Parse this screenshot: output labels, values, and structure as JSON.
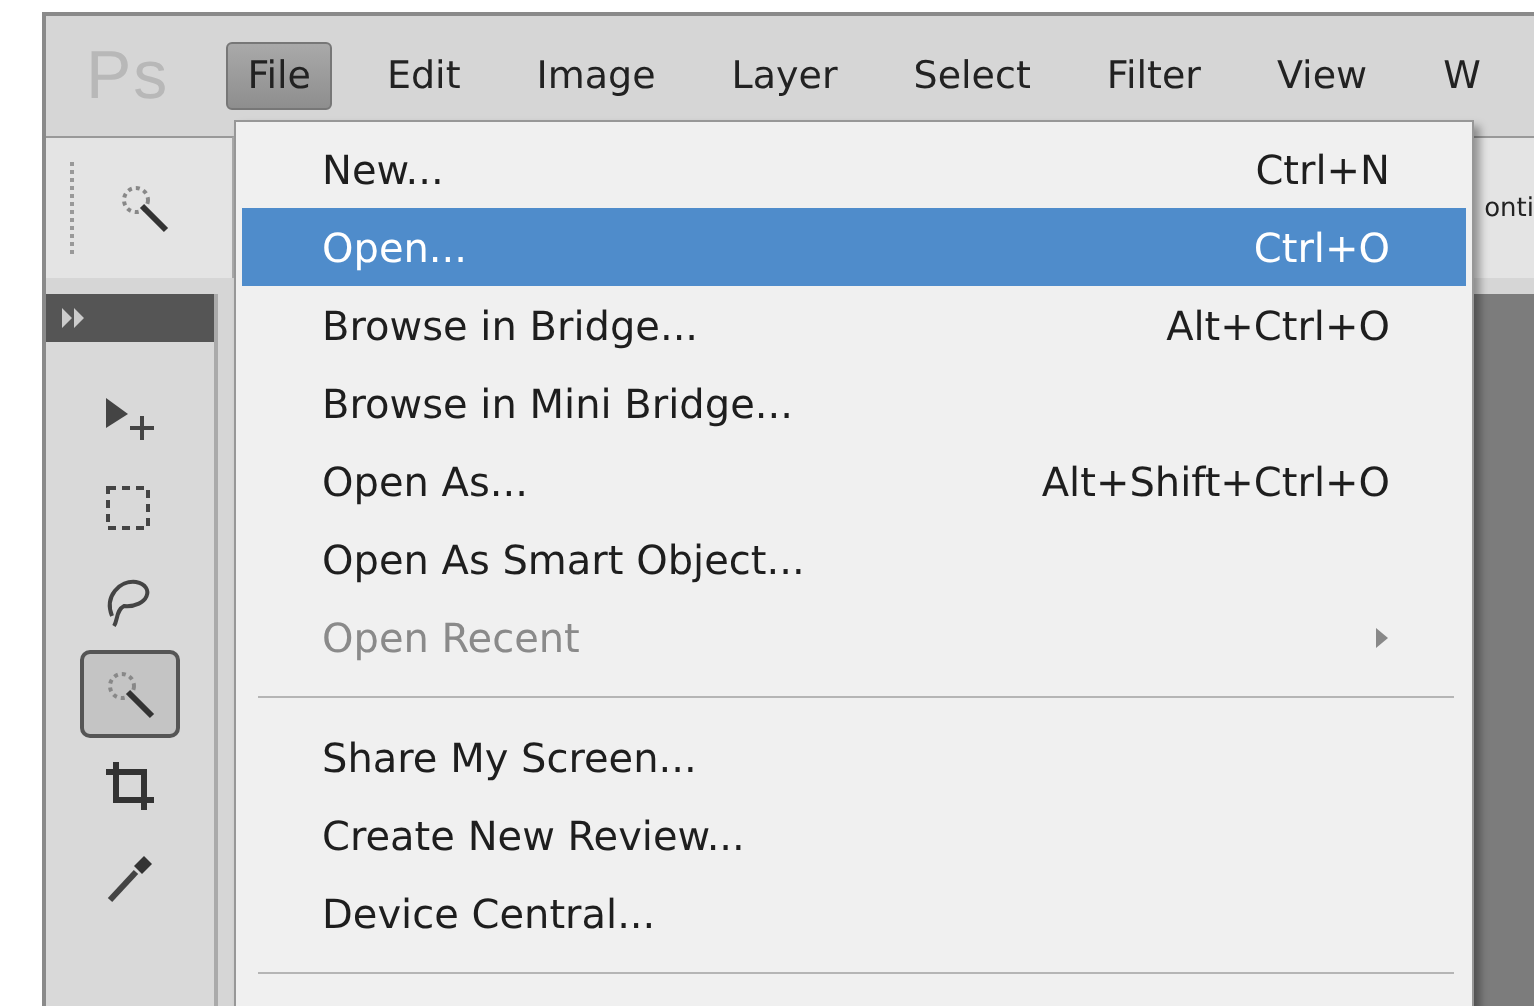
{
  "app_logo": "Ps",
  "menu_bar": [
    {
      "label": "File",
      "selected": true
    },
    {
      "label": "Edit",
      "selected": false
    },
    {
      "label": "Image",
      "selected": false
    },
    {
      "label": "Layer",
      "selected": false
    },
    {
      "label": "Select",
      "selected": false
    },
    {
      "label": "Filter",
      "selected": false
    },
    {
      "label": "View",
      "selected": false
    },
    {
      "label": "W",
      "selected": false
    }
  ],
  "options_bar": {
    "text": "onti"
  },
  "tools": [
    {
      "kind": "move",
      "selected": false
    },
    {
      "kind": "marquee",
      "selected": false
    },
    {
      "kind": "lasso",
      "selected": false
    },
    {
      "kind": "wand",
      "selected": true
    },
    {
      "kind": "crop",
      "selected": false
    },
    {
      "kind": "eyedropper",
      "selected": false
    }
  ],
  "file_menu": [
    {
      "kind": "item",
      "label": "New...",
      "shortcut": "Ctrl+N",
      "selected": false,
      "disabled": false
    },
    {
      "kind": "item",
      "label": "Open...",
      "shortcut": "Ctrl+O",
      "selected": true,
      "disabled": false
    },
    {
      "kind": "item",
      "label": "Browse in Bridge...",
      "shortcut": "Alt+Ctrl+O",
      "selected": false,
      "disabled": false
    },
    {
      "kind": "item",
      "label": "Browse in Mini Bridge...",
      "selected": false,
      "disabled": false
    },
    {
      "kind": "item",
      "label": "Open As...",
      "shortcut": "Alt+Shift+Ctrl+O",
      "selected": false,
      "disabled": false
    },
    {
      "kind": "item",
      "label": "Open As Smart Object...",
      "selected": false,
      "disabled": false
    },
    {
      "kind": "submenu",
      "label": "Open Recent",
      "selected": false,
      "disabled": true
    },
    {
      "kind": "separator"
    },
    {
      "kind": "item",
      "label": "Share My Screen...",
      "selected": false,
      "disabled": false
    },
    {
      "kind": "item",
      "label": "Create New Review...",
      "selected": false,
      "disabled": false
    },
    {
      "kind": "item",
      "label": "Device Central...",
      "selected": false,
      "disabled": false
    },
    {
      "kind": "separator"
    }
  ]
}
